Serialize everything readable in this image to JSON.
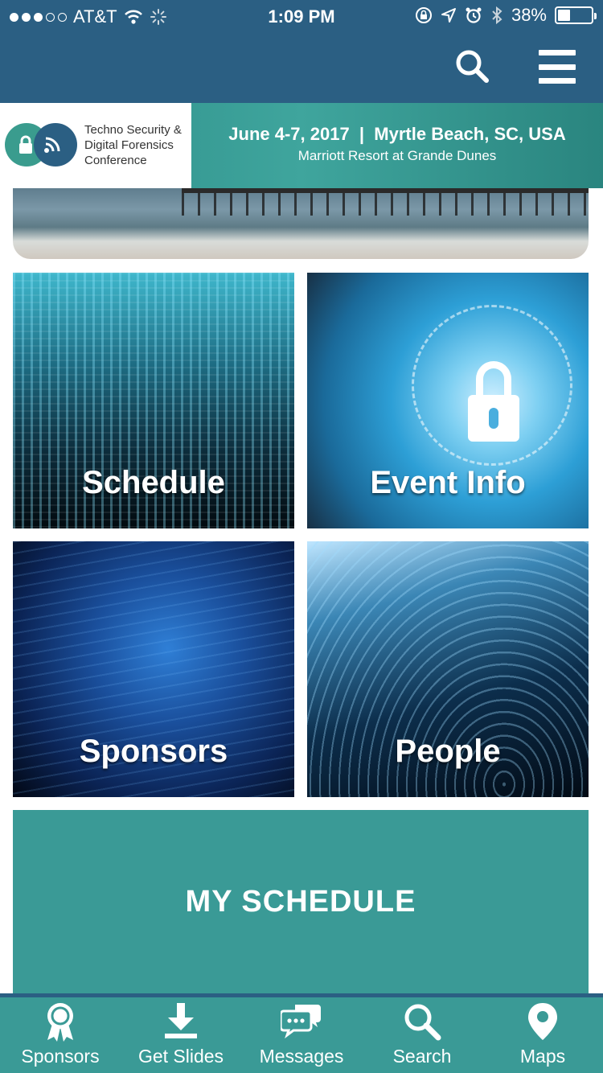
{
  "status_bar": {
    "carrier": "AT&T",
    "time": "1:09 PM",
    "battery": "38%",
    "battery_level": 0.38,
    "signal_bars": 3,
    "signal_total": 5
  },
  "header": {
    "search_icon": "search-icon",
    "menu_icon": "hamburger-menu-icon"
  },
  "banner": {
    "logo_line1": "Techno Security &",
    "logo_line2": "Digital Forensics",
    "logo_line3": "Conference",
    "dates": "June 4-7, 2017  |  Myrtle Beach, SC, USA",
    "venue": "Marriott Resort at Grande Dunes"
  },
  "tiles": {
    "schedule": "Schedule",
    "event_info": "Event Info",
    "sponsors": "Sponsors",
    "people": "People"
  },
  "my_schedule": "MY SCHEDULE",
  "tabbar": {
    "items": [
      {
        "label": "Sponsors",
        "icon": "award-ribbon-icon"
      },
      {
        "label": "Get Slides",
        "icon": "download-icon"
      },
      {
        "label": "Messages",
        "icon": "chat-bubbles-icon"
      },
      {
        "label": "Search",
        "icon": "search-icon"
      },
      {
        "label": "Maps",
        "icon": "map-pin-icon"
      }
    ]
  },
  "colors": {
    "header_blue": "#2b5f83",
    "teal": "#3a9a96"
  }
}
